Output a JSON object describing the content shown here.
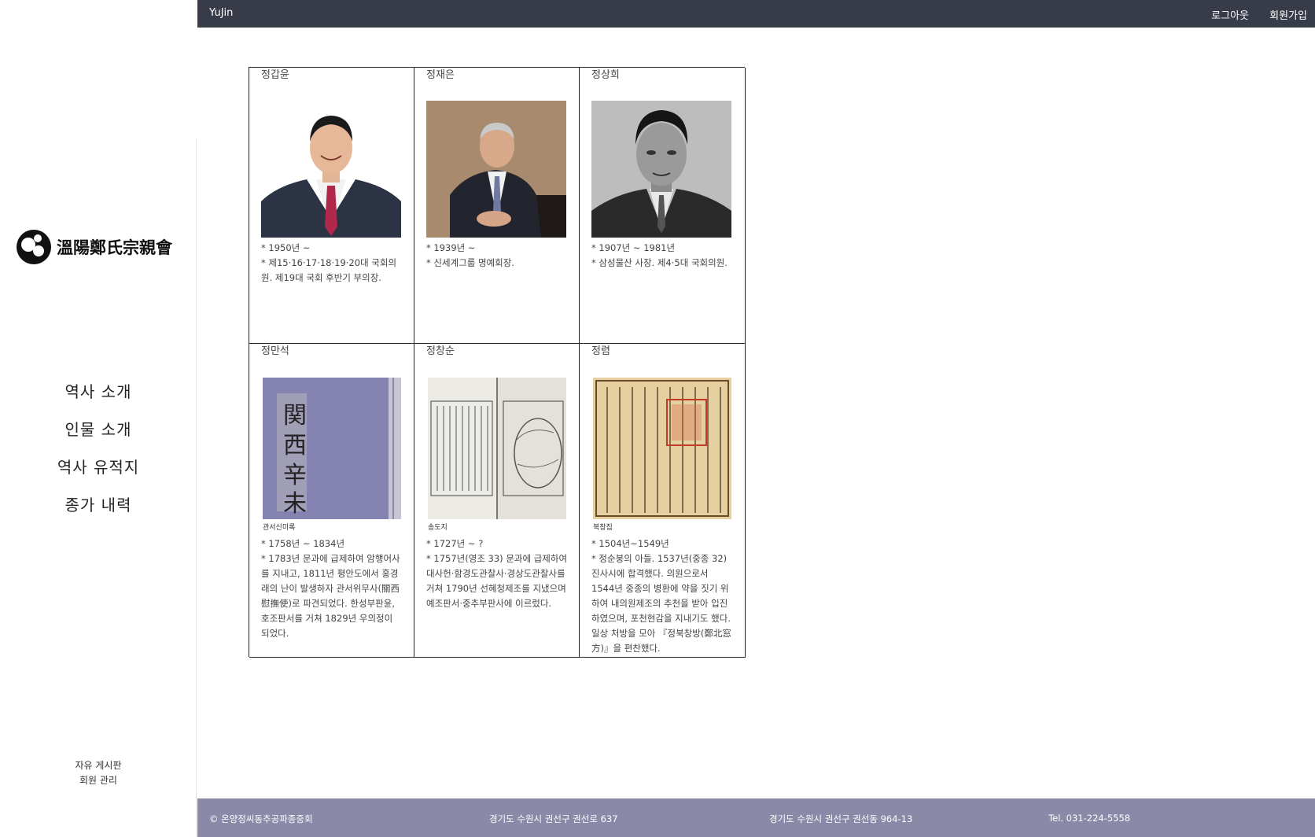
{
  "topbar": {
    "brand": "YuJin",
    "logout": "로그아웃",
    "signup": "회원가입"
  },
  "sidebar": {
    "logo_text": "溫陽鄭氏宗親會",
    "nav": [
      "역사 소개",
      "인물 소개",
      "역사 유적지",
      "종가 내력"
    ],
    "sub_nav": [
      "자유 게시판",
      "회원 관리"
    ]
  },
  "people": [
    {
      "name": "정갑윤",
      "lines": [
        "* 1950년 ~",
        "* 제15·16·17·18·19·20대 국회의원. 제19대 국회 후반기 부의장."
      ]
    },
    {
      "name": "정재은",
      "lines": [
        "* 1939년 ~",
        "* 신세계그룹 명예회장."
      ]
    },
    {
      "name": "정상희",
      "lines": [
        "* 1907년 ~ 1981년",
        "* 삼성물산 사장. 제4·5대 국회의원."
      ]
    },
    {
      "name": "정만석",
      "caption": "관서신미록",
      "lines": [
        "* 1758년 ~ 1834년",
        "* 1783년 문과에 급제하여 암행어사를 지내고, 1811년 평안도에서 홍경래의 난이 발생하자 관서위무사(關西慰撫使)로 파견되었다. 한성부판윤, 호조판서를 거쳐 1829년 우의정이 되었다."
      ]
    },
    {
      "name": "정창순",
      "caption": "송도지",
      "lines": [
        "* 1727년 ~ ?",
        "* 1757년(영조 33) 문과에 급제하여 대사헌·함경도관찰사·경상도관찰사를 거쳐 1790년 선혜청제조를 지냈으며 예조판서·중추부판사에 이르렀다."
      ]
    },
    {
      "name": "정렴",
      "caption": "북창집",
      "lines": [
        "* 1504년~1549년",
        "* 정순붕의 아들. 1537년(중종 32) 진사시에 합격했다. 의원으로서 1544년 중종의 병환에 약을 짓기 위하여 내의원제조의 추천을 받아 입진하였으며, 포천현감을 지내기도 했다. 일상 처방을 모아 『정북창방(鄭北窓方)』을 편찬했다."
      ]
    }
  ],
  "footer": {
    "copyright": "© 온양정씨동추공파종중회",
    "address1": "경기도 수원시 권선구 권선로 637",
    "address2": "경기도 수원시 권선구 권선동 964-13",
    "tel": "Tel. 031-224-5558"
  }
}
